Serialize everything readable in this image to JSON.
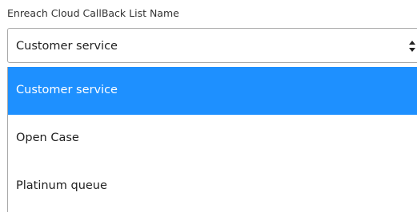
{
  "field": {
    "label": "Enreach Cloud CallBack List Name",
    "selected_value": "Customer service"
  },
  "dropdown": {
    "options": [
      {
        "label": "Customer service",
        "selected": true
      },
      {
        "label": "Open Case",
        "selected": false
      },
      {
        "label": "Platinum queue",
        "selected": false
      }
    ]
  },
  "colors": {
    "highlight": "#1e90ff",
    "border": "#a9a9a9"
  },
  "icons": {
    "select_arrows": "up-down-arrows-icon"
  }
}
